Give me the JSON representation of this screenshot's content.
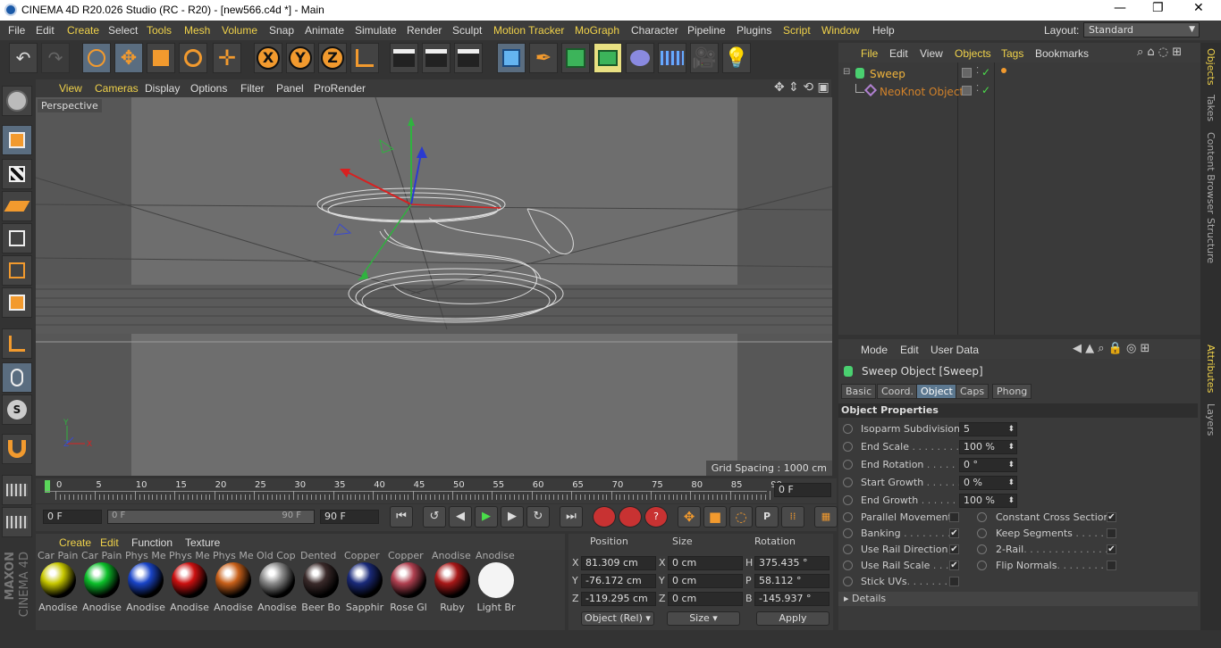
{
  "window": {
    "title": "CINEMA 4D R20.026 Studio (RC - R20) - [new566.c4d *] - Main"
  },
  "menu": [
    "File",
    "Edit",
    "Create",
    "Select",
    "Tools",
    "Mesh",
    "Volume",
    "Snap",
    "Animate",
    "Simulate",
    "Render",
    "Sculpt",
    "Motion Tracker",
    "MoGraph",
    "Character",
    "Pipeline",
    "Plugins",
    "Script",
    "Window",
    "Help"
  ],
  "layout": {
    "label": "Layout:",
    "value": "Standard"
  },
  "viewport": {
    "menu": [
      "View",
      "Cameras",
      "Display",
      "Options",
      "Filter",
      "Panel",
      "ProRender"
    ],
    "label": "Perspective",
    "grid_spacing": "Grid Spacing : 1000 cm"
  },
  "timeline": {
    "ticks": [
      "0",
      "5",
      "10",
      "15",
      "20",
      "25",
      "30",
      "35",
      "40",
      "45",
      "50",
      "55",
      "60",
      "65",
      "70",
      "75",
      "80",
      "85",
      "90"
    ],
    "current_frame": "0 F",
    "start": "0 F",
    "range_start": "0 F",
    "range_end": "90 F",
    "end": "90 F"
  },
  "materials": {
    "menu": [
      "Create",
      "Edit",
      "Function",
      "Texture"
    ],
    "top_labels": [
      "Car Pain",
      "Car Pain",
      "Phys Me",
      "Phys Me",
      "Phys Me",
      "Old Cop",
      "Dented",
      "Copper",
      "Copper",
      "Anodise",
      "Anodise"
    ],
    "items": [
      {
        "name": "Anodise",
        "color": "#c8c800"
      },
      {
        "name": "Anodise",
        "color": "#0cbf2a"
      },
      {
        "name": "Anodise",
        "color": "#1a45c8"
      },
      {
        "name": "Anodise",
        "color": "#cc1010"
      },
      {
        "name": "Anodise",
        "color": "#c8601a"
      },
      {
        "name": "Anodise",
        "color": "#8a8a8a"
      },
      {
        "name": "Beer Bo",
        "color": "#3a2a2a"
      },
      {
        "name": "Sapphir",
        "color": "#1a2a7a"
      },
      {
        "name": "Rose Gl",
        "color": "#b04050"
      },
      {
        "name": "Ruby",
        "color": "#a81818"
      },
      {
        "name": "Light Br",
        "color": "#f4f4f4"
      }
    ]
  },
  "coords": {
    "headers": {
      "position": "Position",
      "size": "Size",
      "rotation": "Rotation"
    },
    "rows": [
      {
        "axis": "X",
        "pos": "81.309 cm",
        "size_axis": "X",
        "size": "0 cm",
        "rot_axis": "H",
        "rot": "375.435 °"
      },
      {
        "axis": "Y",
        "pos": "-76.172 cm",
        "size_axis": "Y",
        "size": "0 cm",
        "rot_axis": "P",
        "rot": "58.112 °"
      },
      {
        "axis": "Z",
        "pos": "-119.295 cm",
        "size_axis": "Z",
        "size": "0 cm",
        "rot_axis": "B",
        "rot": "-145.937 °"
      }
    ],
    "mode": "Object (Rel)",
    "size_mode": "Size",
    "apply": "Apply"
  },
  "objects": {
    "menu": [
      "File",
      "Edit",
      "View",
      "Objects",
      "Tags",
      "Bookmarks"
    ],
    "items": [
      {
        "name": "Sweep"
      },
      {
        "name": "NeoKnot Object"
      }
    ]
  },
  "attributes": {
    "menu": [
      "Mode",
      "Edit",
      "User Data"
    ],
    "title": "Sweep Object [Sweep]",
    "tabs": [
      "Basic",
      "Coord.",
      "Object",
      "Caps",
      "Phong"
    ],
    "selected_tab": "Object",
    "section": "Object Properties",
    "props": [
      {
        "label": "Isoparm Subdivision",
        "value": "5"
      },
      {
        "label": "End Scale",
        "dots": " . . . . . . . . .",
        "value": "100 %"
      },
      {
        "label": "End Rotation",
        "dots": " . . . . . .",
        "value": "0 °"
      },
      {
        "label": "Start Growth",
        "dots": " . . . . . .",
        "value": "0 %"
      },
      {
        "label": "End Growth",
        "dots": " . . . . . . .",
        "value": "100 %"
      }
    ],
    "checks_left": [
      {
        "label": "Parallel Movement",
        "checked": false
      },
      {
        "label": "Banking",
        "dots": " . . . . . . . .",
        "checked": true
      },
      {
        "label": "Use Rail Direction",
        "checked": true
      },
      {
        "label": "Use Rail Scale",
        "dots": " . . . .",
        "checked": true
      },
      {
        "label": "Stick UVs",
        "dots": ". . . . . . . .",
        "checked": false
      }
    ],
    "checks_right": [
      {
        "label": "Constant Cross Section",
        "checked": true
      },
      {
        "label": "Keep Segments",
        "dots": " . . . . . . .",
        "checked": false
      },
      {
        "label": "2-Rail",
        "dots": ". . . . . . . . . . . . . . .",
        "checked": true
      },
      {
        "label": "Flip Normals",
        "dots": ". . . . . . . . .",
        "checked": false
      }
    ],
    "details": "Details",
    "check_glyph": "✔"
  },
  "side_tabs": {
    "top": [
      "Objects",
      "Takes",
      "Content Browser",
      "Structure"
    ],
    "bottom": [
      "Attributes",
      "Layers"
    ]
  },
  "brand": {
    "maxon": "MAXON",
    "product": "CINEMA 4D"
  },
  "window_controls": {
    "minimize": "—",
    "maximize": "❐",
    "close": "✕"
  }
}
